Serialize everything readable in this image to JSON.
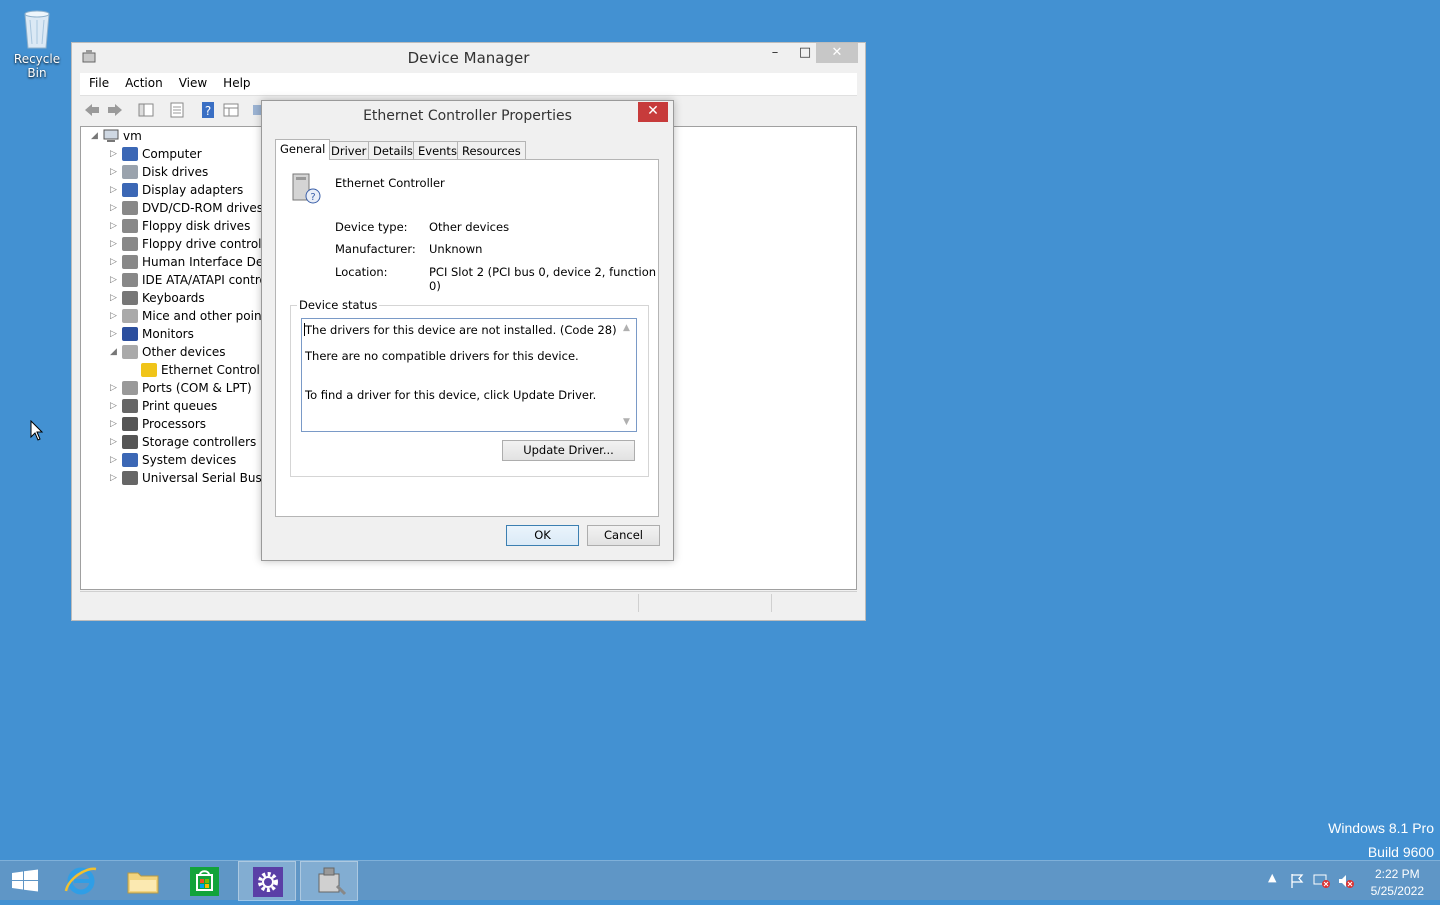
{
  "desktop": {
    "recycle_bin_label": "Recycle Bin",
    "watermark": {
      "line1": "Windows 8.1 Pro",
      "line2": "Build 9600"
    }
  },
  "device_manager": {
    "title": "Device Manager",
    "menu": [
      "File",
      "Action",
      "View",
      "Help"
    ],
    "tree": {
      "root": "vm",
      "categories": [
        {
          "label": "Computer",
          "icon": "computer-icon"
        },
        {
          "label": "Disk drives",
          "icon": "disk-drive-icon"
        },
        {
          "label": "Display adapters",
          "icon": "display-adapter-icon"
        },
        {
          "label": "DVD/CD-ROM drives",
          "icon": "dvd-drive-icon"
        },
        {
          "label": "Floppy disk drives",
          "icon": "floppy-disk-icon"
        },
        {
          "label": "Floppy drive controller",
          "icon": "floppy-controller-icon"
        },
        {
          "label": "Human Interface Devic",
          "icon": "hid-icon"
        },
        {
          "label": "IDE ATA/ATAPI contro",
          "icon": "ide-controller-icon"
        },
        {
          "label": "Keyboards",
          "icon": "keyboard-icon"
        },
        {
          "label": "Mice and other pointir",
          "icon": "mouse-icon"
        },
        {
          "label": "Monitors",
          "icon": "monitor-icon"
        },
        {
          "label": "Other devices",
          "icon": "other-devices-icon",
          "expanded": true
        },
        {
          "label": "Ethernet Controller",
          "icon": "warning-device-icon",
          "child": true
        },
        {
          "label": "Ports (COM & LPT)",
          "icon": "port-icon"
        },
        {
          "label": "Print queues",
          "icon": "printer-icon"
        },
        {
          "label": "Processors",
          "icon": "processor-icon"
        },
        {
          "label": "Storage controllers",
          "icon": "storage-controller-icon"
        },
        {
          "label": "System devices",
          "icon": "system-device-icon"
        },
        {
          "label": "Universal Serial Bus co",
          "icon": "usb-icon"
        }
      ]
    }
  },
  "properties_dialog": {
    "title": "Ethernet Controller Properties",
    "tabs": [
      "General",
      "Driver",
      "Details",
      "Events",
      "Resources"
    ],
    "active_tab": "General",
    "device_name": "Ethernet Controller",
    "device_type_label": "Device type:",
    "device_type_value": "Other devices",
    "manufacturer_label": "Manufacturer:",
    "manufacturer_value": "Unknown",
    "location_label": "Location:",
    "location_value": "PCI Slot 2 (PCI bus 0, device 2, function 0)",
    "status_group_label": "Device status",
    "status_lines": [
      "The drivers for this device are not installed. (Code 28)",
      "There are no compatible drivers for this device.",
      "To find a driver for this device, click Update Driver."
    ],
    "update_driver_label": "Update Driver...",
    "ok_label": "OK",
    "cancel_label": "Cancel"
  },
  "taskbar": {
    "clock_time": "2:22 PM",
    "clock_date": "5/25/2022",
    "colors": {
      "taskbar": "#5f96c6",
      "desktop": "#4391d2",
      "store": "#12a33a",
      "settings": "#5a3fa6"
    }
  }
}
